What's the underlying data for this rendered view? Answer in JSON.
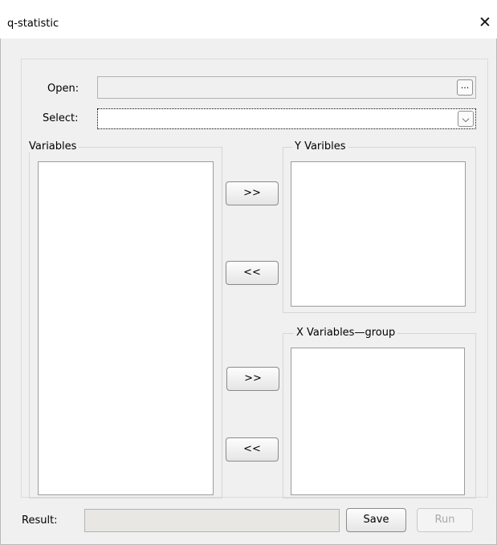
{
  "window": {
    "title": "q-statistic",
    "close_glyph": "✕"
  },
  "open": {
    "label": "Open:",
    "value": "",
    "browse_glyph": "···"
  },
  "select": {
    "label": "Select:",
    "value": "",
    "dropdown_glyph": "⌵"
  },
  "variables": {
    "legend": "Variables",
    "items": []
  },
  "y_variables": {
    "legend": "Y Varibles",
    "items": []
  },
  "x_variables": {
    "legend": "X Variables—group",
    "items": []
  },
  "buttons": {
    "add_y": ">>",
    "remove_y": "<<",
    "add_x": ">>",
    "remove_x": "<<",
    "save": "Save",
    "run": "Run"
  },
  "result": {
    "label": "Result:",
    "value": ""
  },
  "colors": {
    "window_bg": "#f0f0f0",
    "titlebar_bg": "#ffffff",
    "list_bg": "#ffffff",
    "disabled_text": "#a8a8a8"
  }
}
